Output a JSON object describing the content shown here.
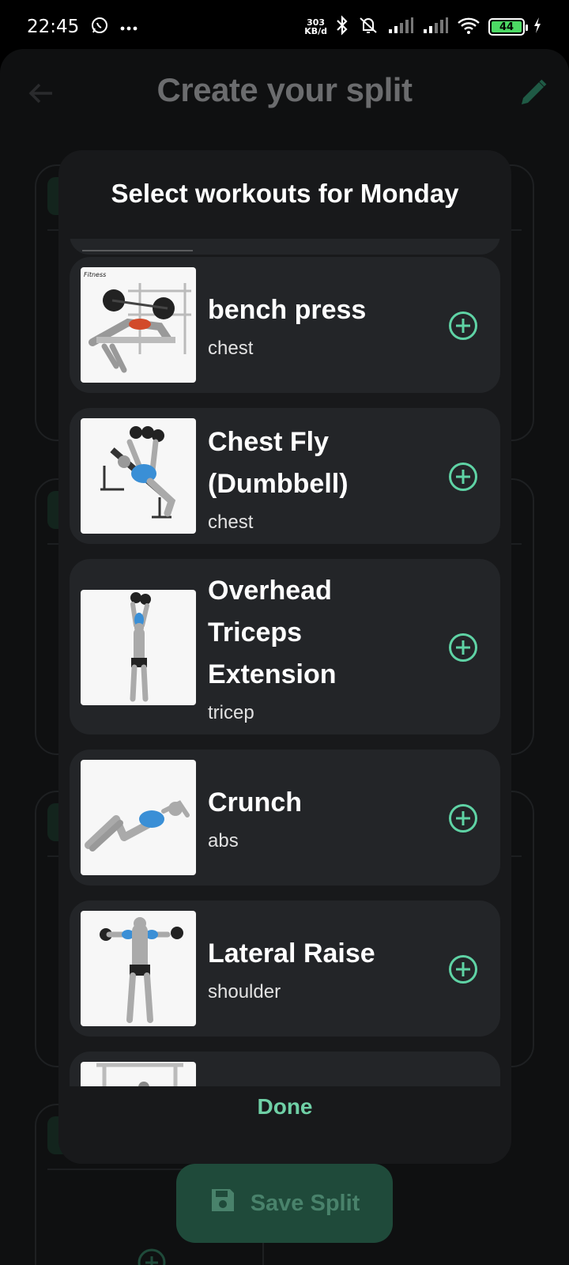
{
  "status_bar": {
    "time": "22:45",
    "net_speed_value": "303",
    "net_speed_unit": "KB/d",
    "battery": "44"
  },
  "header": {
    "title": "Create your split"
  },
  "modal": {
    "title": "Select workouts for Monday",
    "done_label": "Done",
    "exercises": [
      {
        "name": "bench press",
        "muscle": "chest"
      },
      {
        "name": "Chest Fly (Dumbbell)",
        "muscle": "chest"
      },
      {
        "name": "Overhead Triceps Extension",
        "muscle": "tricep"
      },
      {
        "name": "Crunch",
        "muscle": "abs"
      },
      {
        "name": "Lateral Raise",
        "muscle": "shoulder"
      }
    ]
  },
  "save_button": {
    "label": "Save Split"
  },
  "colors": {
    "accent": "#5fd3a5",
    "modal_bg": "#18191b",
    "card_bg": "#232528"
  }
}
